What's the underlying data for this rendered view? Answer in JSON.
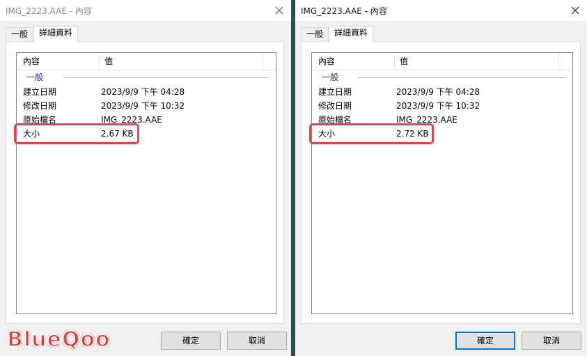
{
  "windows": [
    {
      "title": "IMG_2223.AAE - 內容",
      "tabs": [
        {
          "label": "一般",
          "active": false
        },
        {
          "label": "詳細資料",
          "active": true
        }
      ],
      "columns": {
        "property": "內容",
        "value": "值"
      },
      "group": "一般",
      "rows": [
        {
          "name": "建立日期",
          "value": "2023/9/9 下午 04:28"
        },
        {
          "name": "修改日期",
          "value": "2023/9/9 下午 10:32"
        },
        {
          "name": "原始檔名",
          "value": "IMG_2223.AAE"
        },
        {
          "name": "大小",
          "value": "2.67 KB"
        }
      ],
      "buttons": {
        "ok": "確定",
        "cancel": "取消"
      }
    },
    {
      "title": "IMG_2223.AAE - 內容",
      "tabs": [
        {
          "label": "一般",
          "active": false
        },
        {
          "label": "詳細資料",
          "active": true
        }
      ],
      "columns": {
        "property": "內容",
        "value": "值"
      },
      "group": "一般",
      "rows": [
        {
          "name": "建立日期",
          "value": "2023/9/9 下午 04:28"
        },
        {
          "name": "修改日期",
          "value": "2023/9/9 下午 10:32"
        },
        {
          "name": "原始檔名",
          "value": "IMG_2223.AAE"
        },
        {
          "name": "大小",
          "value": "2.72 KB"
        }
      ],
      "buttons": {
        "ok": "確定",
        "cancel": "取消"
      }
    }
  ],
  "watermark": "BlueQoo",
  "colors": {
    "highlight": "#e0454f",
    "accent": "#0078d7",
    "group": "#1e3287",
    "logo": "#e53935"
  },
  "icons": {
    "close": "close-icon"
  }
}
